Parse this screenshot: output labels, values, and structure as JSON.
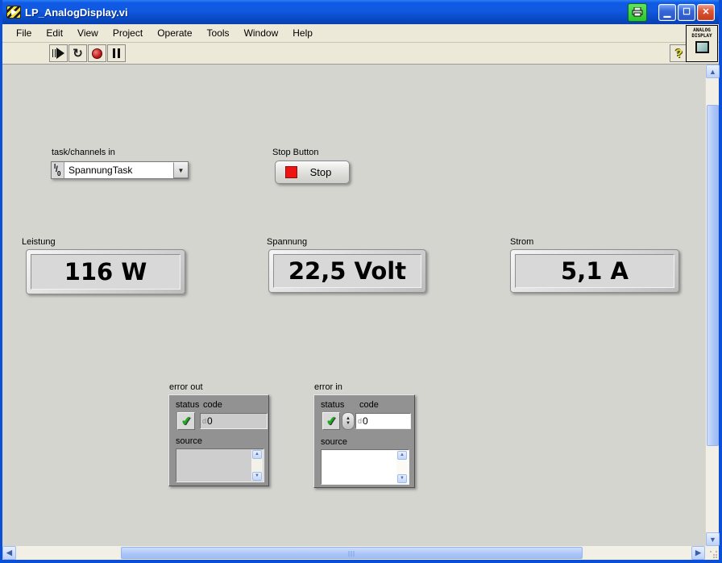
{
  "window": {
    "title": "LP_AnalogDisplay.vi"
  },
  "menu": {
    "items": [
      "File",
      "Edit",
      "View",
      "Project",
      "Operate",
      "Tools",
      "Window",
      "Help"
    ]
  },
  "toolbar": {
    "help_label": "?",
    "vi_icon_line1": "ANALOG",
    "vi_icon_line2": "DISPLAY"
  },
  "panel": {
    "task_channels": {
      "label": "task/channels in",
      "value": "SpannungTask",
      "io_top": "I",
      "io_slash": "/",
      "io_bottom": "0",
      "arrow": "▼"
    },
    "stop_button": {
      "label": "Stop Button",
      "button_text": "Stop"
    },
    "displays": [
      {
        "label": "Leistung",
        "value": "116 W"
      },
      {
        "label": "Spannung",
        "value": "22,5 Volt"
      },
      {
        "label": "Strom",
        "value": "5,1 A"
      }
    ],
    "error_out": {
      "label": "error out",
      "status_label": "status",
      "status_check": "✔",
      "code_label": "code",
      "code_radix": "d",
      "code_value": "0",
      "source_label": "source",
      "source_value": ""
    },
    "error_in": {
      "label": "error in",
      "status_label": "status",
      "status_check": "✔",
      "code_label": "code",
      "code_radix": "d",
      "code_value": "0",
      "source_label": "source",
      "source_value": ""
    }
  },
  "colors": {
    "titlebar_blue": "#1059e0",
    "xp_beige": "#ece9d8",
    "panel_gray": "#d5d5d0",
    "cluster_gray": "#929292",
    "stop_red": "#ee1414",
    "check_green": "#1faa1f",
    "scroll_thumb_blue": "#aac5f7"
  }
}
